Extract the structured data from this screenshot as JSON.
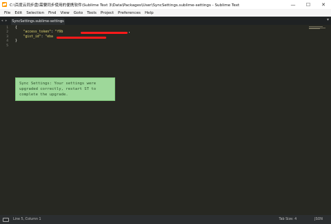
{
  "window": {
    "title": "C:\\百度云同步盘\\需要同步使用的便携软件\\Sublime Text 3\\Data\\Packages\\User\\SyncSettings.sublime-settings - Sublime Text",
    "minimize": "—",
    "maximize": "☐",
    "close": "✕"
  },
  "menu": [
    "File",
    "Edit",
    "Selection",
    "Find",
    "View",
    "Goto",
    "Tools",
    "Project",
    "Preferences",
    "Help"
  ],
  "tabs": {
    "nav_left": "◂",
    "nav_right": "▸",
    "active_label": "SyncSettings.sublime-settings",
    "close": "×",
    "more": "▾"
  },
  "editor": {
    "line_numbers": [
      "1",
      "2",
      "3",
      "4",
      "5"
    ],
    "lines": [
      {
        "text": "{"
      },
      {
        "indent": "    ",
        "key": "\"access_token\"",
        "sep": ": ",
        "value": "\"f9b",
        "tail": ","
      },
      {
        "indent": "    ",
        "key": "\"gist_id\"",
        "sep": ": ",
        "value": "\"eba",
        "tail": ""
      },
      {
        "text": "}"
      },
      {
        "text": ""
      }
    ]
  },
  "popup": {
    "line1": "Sync Settings: Your settings were",
    "line2": "upgraded correctly, restart ST to",
    "line3": "complete the upgrade."
  },
  "status": {
    "position": "Line 5, Column 1",
    "tab_size": "Tab Size: 4",
    "syntax": "JSON"
  },
  "colors": {
    "editor_bg": "#272822",
    "popup_bg": "#9ed89a",
    "redaction": "#ff1a1a"
  }
}
